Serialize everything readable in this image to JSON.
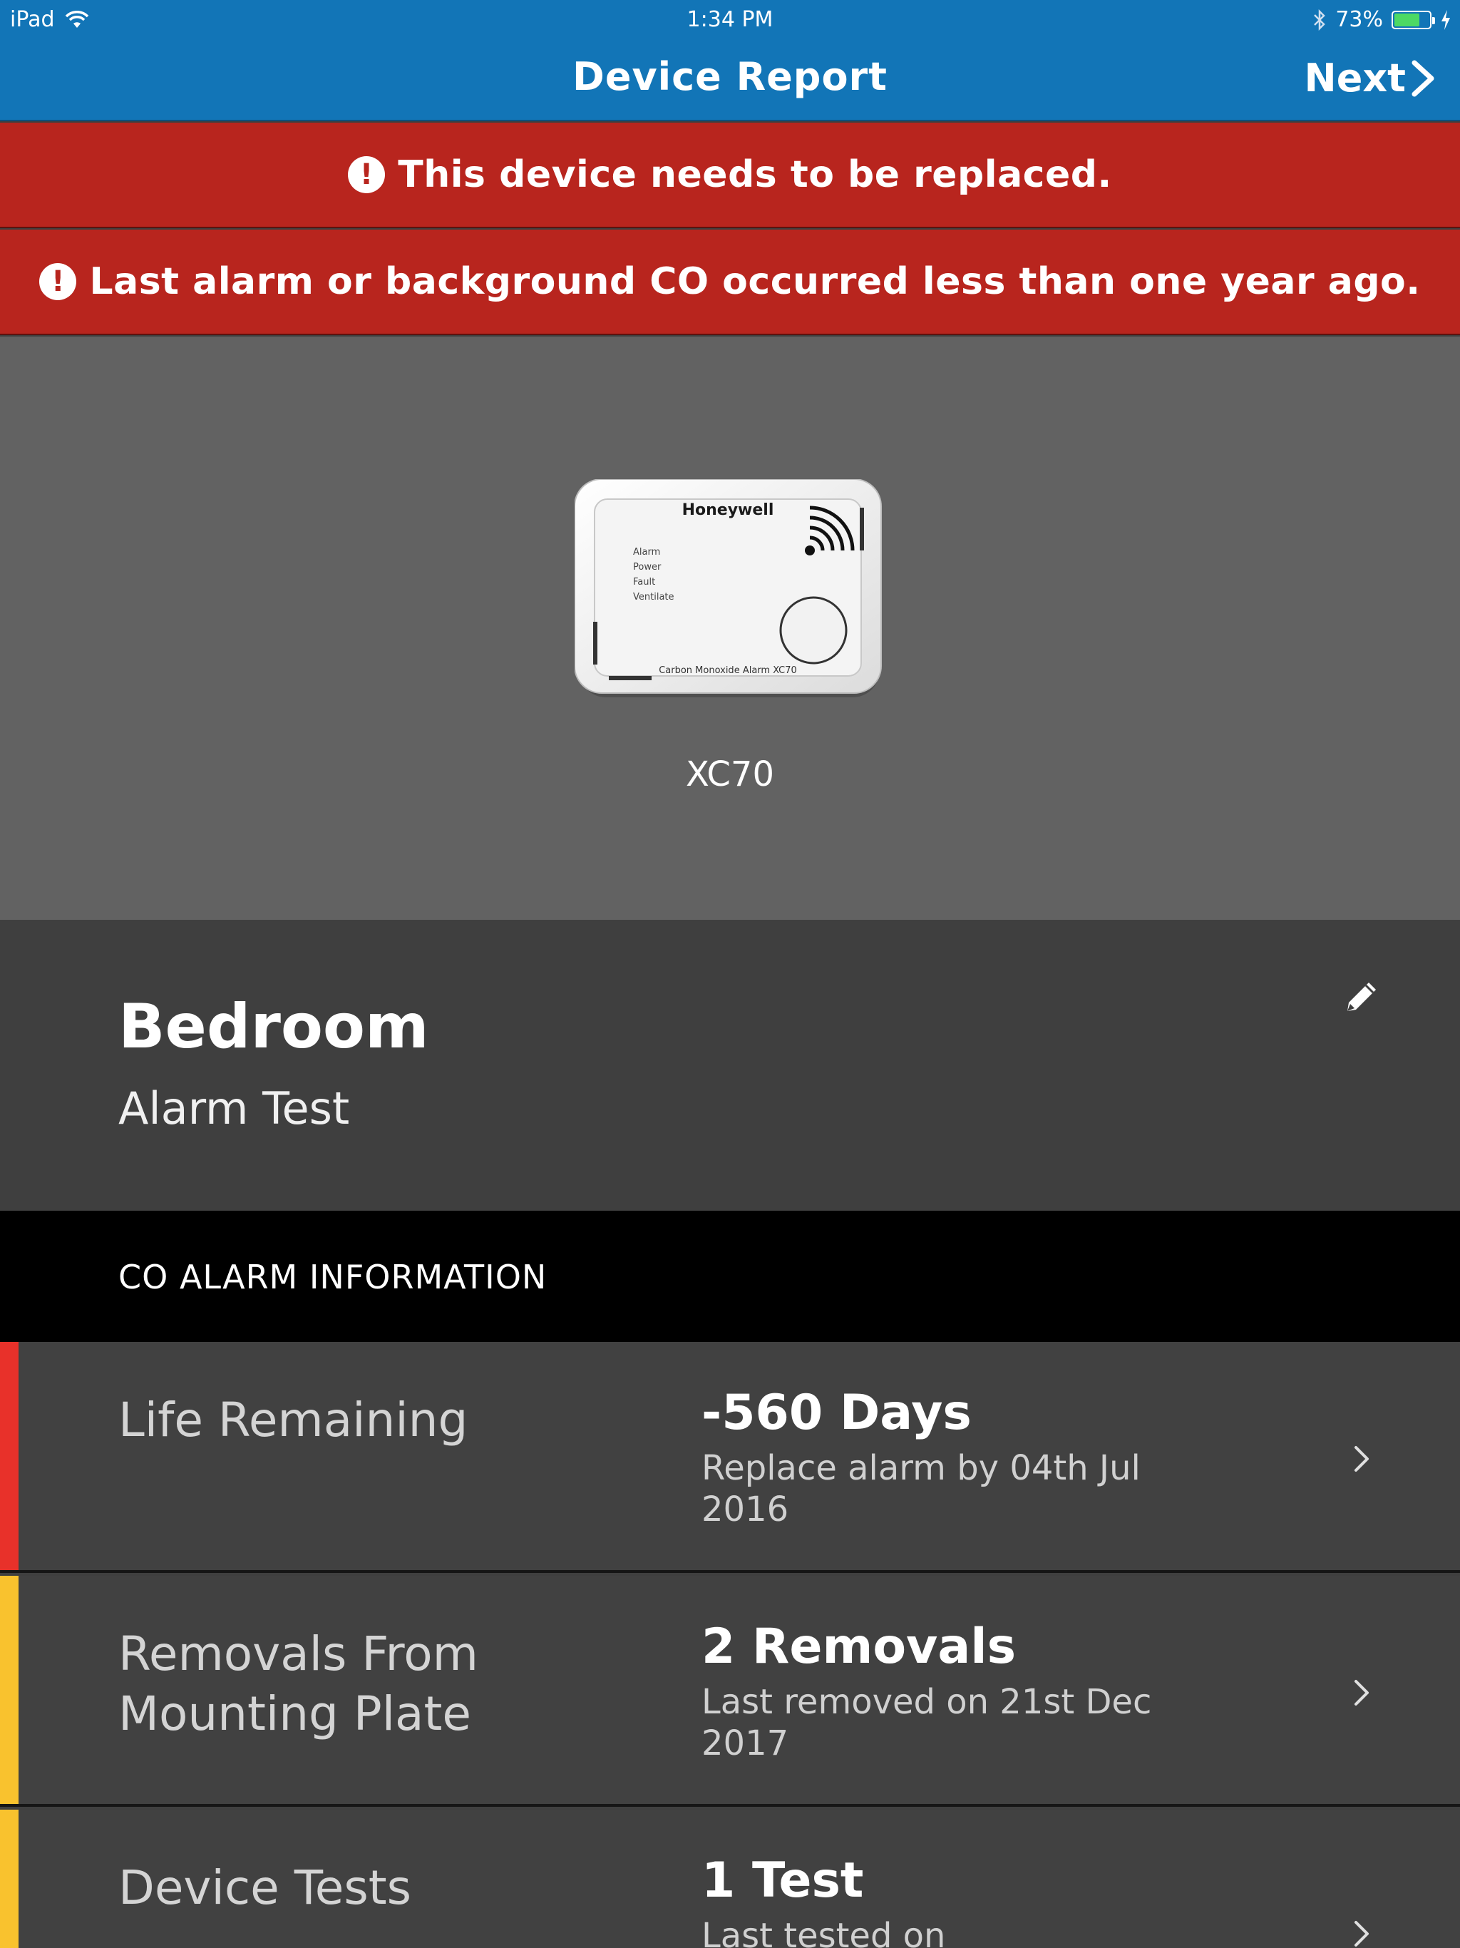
{
  "status_bar": {
    "device": "iPad",
    "time": "1:34 PM",
    "battery": "73%",
    "battery_level": 0.73
  },
  "nav": {
    "title": "Device Report",
    "next_label": "Next"
  },
  "banners": [
    {
      "text": "This device needs to be replaced.",
      "icon": "exclamation-circle-icon"
    },
    {
      "text": "Last alarm or background CO occurred less than one year ago.",
      "icon": "exclamation-circle-icon"
    }
  ],
  "device": {
    "model": "XC70",
    "image_brand": "Honeywell",
    "image_indicators": [
      "Alarm",
      "Power",
      "Fault",
      "Ventilate"
    ],
    "image_caption": "Carbon Monoxide Alarm XC70"
  },
  "location": {
    "name": "Bedroom",
    "subtitle": "Alarm Test"
  },
  "section": {
    "title": "CO ALARM INFORMATION"
  },
  "rows": [
    {
      "label": "Life Remaining",
      "value": "-560 Days",
      "detail": "Replace alarm by 04th Jul 2016",
      "status_color": "#e8312a"
    },
    {
      "label": "Removals From Mounting Plate",
      "value": "2 Removals",
      "detail": "Last removed on 21st Dec 2017",
      "status_color": "#f9c22e"
    },
    {
      "label": "Device Tests",
      "value": "1 Test",
      "detail": "Last tested on",
      "status_color": "#f9c22e"
    }
  ],
  "colors": {
    "nav_blue": "#1275b7",
    "banner_red": "#b8251e",
    "device_area": "#626262",
    "row_bg": "#414141"
  }
}
